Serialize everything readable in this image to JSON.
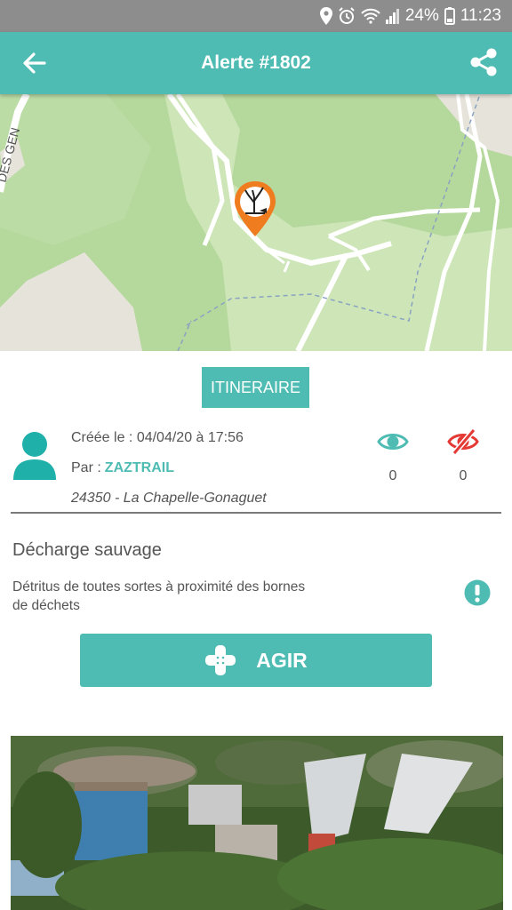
{
  "status_bar": {
    "battery": "24%",
    "time": "11:23",
    "icons": [
      "location-icon",
      "alarm-icon",
      "wifi-icon",
      "signal-icon",
      "battery-icon"
    ]
  },
  "header": {
    "title": "Alerte #1802",
    "back_icon": "arrow-left-icon",
    "share_icon": "share-icon"
  },
  "map": {
    "road_label": "DES GEN",
    "marker_icon": "dead-tree-marker-icon",
    "marker_color": "#f07c20"
  },
  "itinerary_button": {
    "label": "ITINERAIRE"
  },
  "alert_meta": {
    "created": "Créée le : 04/04/20 à 17:56",
    "by_label": "Par :",
    "author": "ZAZTRAIL",
    "location": "24350 - La Chapelle-Gonaguet",
    "seen_count": "0",
    "unseen_count": "0"
  },
  "alert": {
    "title": "Décharge sauvage",
    "description": "Détritus de toutes sortes à proximité des bornes de déchets"
  },
  "action_button": {
    "label": "AGIR",
    "icon": "bandage-plus-icon"
  },
  "colors": {
    "accent": "#4fbcb4",
    "status_bar": "#8d8d8d",
    "danger": "#e53935",
    "text": "#555555"
  }
}
